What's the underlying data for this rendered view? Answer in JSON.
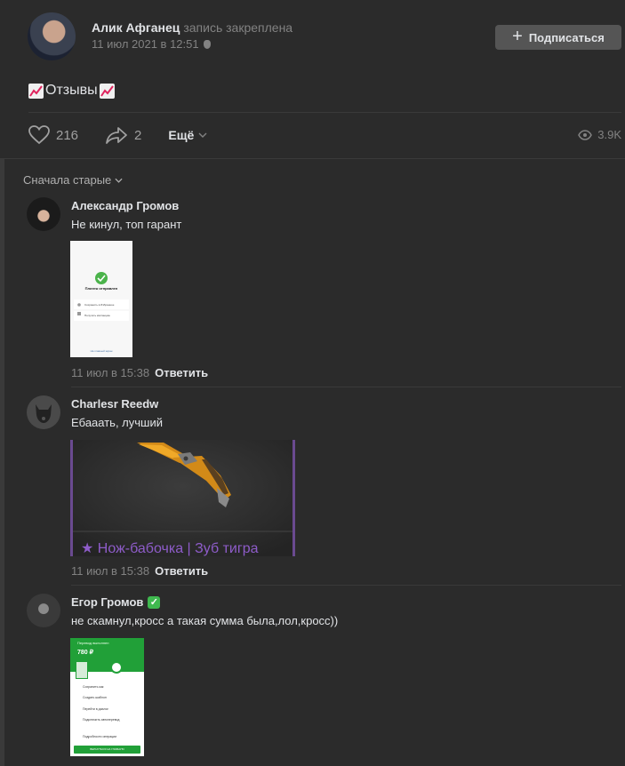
{
  "post": {
    "author": "Алик Афганец",
    "pinned_label": "запись закреплена",
    "date": "11 июл 2021 в 12:51",
    "subscribe_label": "Подписаться",
    "text": "Отзывы",
    "likes": "216",
    "shares": "2",
    "more_label": "Ещё",
    "views": "3.9K"
  },
  "comments_sort": "Сначала старые",
  "comments": [
    {
      "name": "Александр Громов",
      "text": "Не кинул, топ гарант",
      "time": "11 июл в 15:38",
      "reply": "Ответить",
      "thumb": {
        "title": "Платеж отправлен",
        "line1": "Сохранить в Избранное",
        "line2": "Получить квитанцию",
        "footer": "На главный экран"
      }
    },
    {
      "name": "Charlesr Reedw",
      "text": "Ебааать, лучший",
      "time": "11 июл в 15:38",
      "reply": "Ответить",
      "thumb": {
        "caption": "★ Нож-бабочка | Зуб тигра"
      }
    },
    {
      "name": "Егор Громов",
      "text": "не скамнул,кросс а такая сумма была,лол,кросс))",
      "thumb": {
        "header": "Перевод выполнен",
        "amount": "780 ₽",
        "items": [
          "Сохранить как",
          "Создать шаблон",
          "Перейти в диалог",
          "Подключить автоперевод",
          "Подробности операции"
        ],
        "button": "ВЕРНУТЬСЯ НА ГЛАВНУЮ"
      }
    }
  ]
}
